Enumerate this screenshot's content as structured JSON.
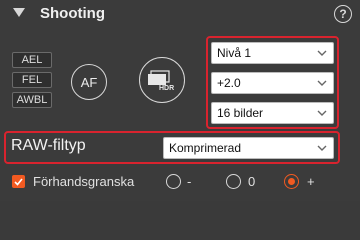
{
  "header": {
    "title": "Shooting",
    "help_glyph": "?"
  },
  "lock_buttons": [
    "AEL",
    "FEL",
    "AWBL"
  ],
  "af_button": {
    "label": "AF"
  },
  "hdr_button": {
    "label": "HDR"
  },
  "selects": {
    "level": "Nivå 1",
    "ev": "+2.0",
    "frames": "16 bilder",
    "raw_type": "Komprimerad"
  },
  "raw_label": "RAW-filtyp",
  "preview": {
    "label": "Förhandsgranska",
    "checked": true,
    "options": [
      {
        "label": "-",
        "selected": false
      },
      {
        "label": "0",
        "selected": false
      },
      {
        "label": "+",
        "selected": true
      }
    ]
  },
  "colors": {
    "accent": "#f25a21",
    "highlight": "#d9232e",
    "panel": "#3b3b3b"
  }
}
